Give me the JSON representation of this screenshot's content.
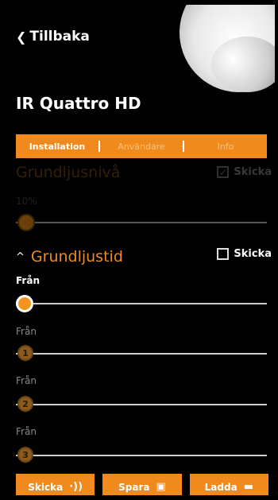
{
  "header": {
    "back_label": "Tillbaka",
    "title": "IR Quattro HD"
  },
  "tabs": [
    {
      "label": "Installation",
      "active": true
    },
    {
      "label": "Användare",
      "active": false
    },
    {
      "label": "Info",
      "active": false
    }
  ],
  "base_level": {
    "title": "Grundljusnivå",
    "send_label": "Skicka",
    "send_checked": true,
    "value_label": "10%",
    "value": 0.1
  },
  "base_time": {
    "title": "Grundljustid",
    "send_label": "Skicka",
    "send_checked": false,
    "rows": [
      {
        "label": "Från",
        "badge": ""
      },
      {
        "label": "Från",
        "badge": "1"
      },
      {
        "label": "Från",
        "badge": "2"
      },
      {
        "label": "Från",
        "badge": "3"
      }
    ]
  },
  "buttons": {
    "send": "Skicka",
    "save": "Spara",
    "load": "Ladda"
  },
  "colors": {
    "accent": "#f08a1c",
    "background": "#000000"
  }
}
